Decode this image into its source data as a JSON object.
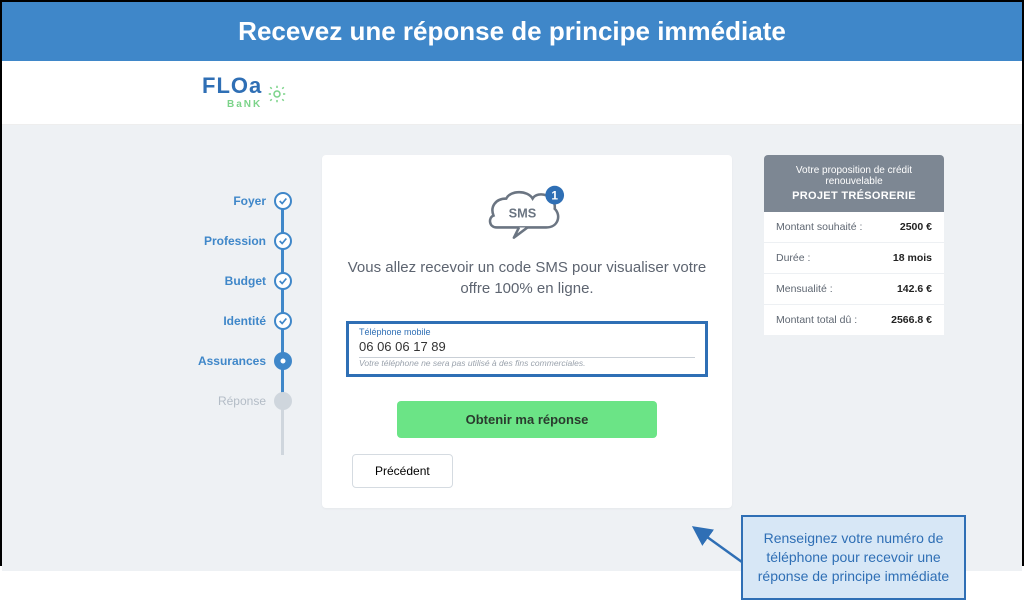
{
  "banner": {
    "title": "Recevez une réponse de principe immédiate"
  },
  "logo": {
    "brand": "FLOa",
    "sub": "BaNK"
  },
  "stepper": {
    "steps": [
      {
        "label": "Foyer",
        "state": "done"
      },
      {
        "label": "Profession",
        "state": "done"
      },
      {
        "label": "Budget",
        "state": "done"
      },
      {
        "label": "Identité",
        "state": "done"
      },
      {
        "label": "Assurances",
        "state": "current"
      },
      {
        "label": "Réponse",
        "state": "pending"
      }
    ]
  },
  "card": {
    "icon_text": "SMS",
    "icon_badge": "1",
    "text": "Vous allez recevoir un code SMS pour visualiser votre offre 100% en ligne.",
    "field_label": "Téléphone mobile",
    "field_value": "06 06 06 17 89",
    "field_hint": "Votre téléphone ne sera pas utilisé à des fins commerciales.",
    "btn_primary": "Obtenir ma réponse",
    "btn_secondary": "Précédent"
  },
  "summary": {
    "head_line1": "Votre proposition de crédit renouvelable",
    "head_line2": "PROJET TRÉSORERIE",
    "rows": [
      {
        "k": "Montant souhaité :",
        "v": "2500 €"
      },
      {
        "k": "Durée :",
        "v": "18 mois"
      },
      {
        "k": "Mensualité :",
        "v": "142.6 €"
      },
      {
        "k": "Montant total dû :",
        "v": "2566.8 €"
      }
    ]
  },
  "callout": {
    "text": "Renseignez votre numéro de téléphone pour recevoir une réponse de principe immédiate"
  }
}
